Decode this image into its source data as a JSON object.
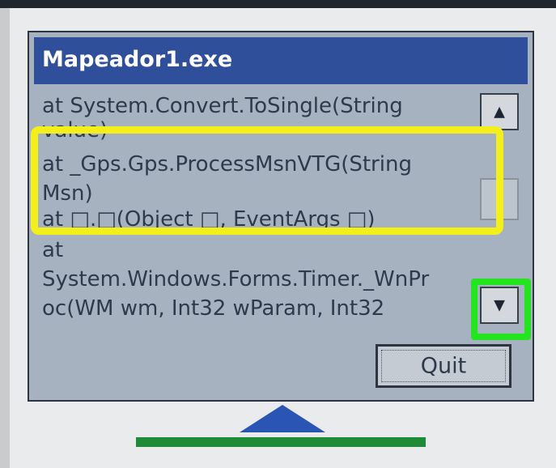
{
  "window": {
    "title": "Mapeador1.exe"
  },
  "error_lines": [
    "   at System.Convert.ToSingle(String",
    "value)",
    "   at _Gps.Gps.ProcessMsnVTG(String",
    "Msn)",
    "   at □.□(Object □, EventArgs □)",
    "   at",
    "System.Windows.Forms.Timer._WnPr",
    "oc(WM wm, Int32 wParam, Int32"
  ],
  "scrollbar": {
    "up_icon": "scroll-up-arrow",
    "down_icon": "scroll-down-arrow"
  },
  "buttons": {
    "quit_label": "Quit"
  },
  "colors": {
    "title_bar": "#2f4f9a",
    "dialog_body": "#a7b2c0",
    "highlight_yellow": "#f3ef1a",
    "highlight_green": "#22e41f"
  }
}
